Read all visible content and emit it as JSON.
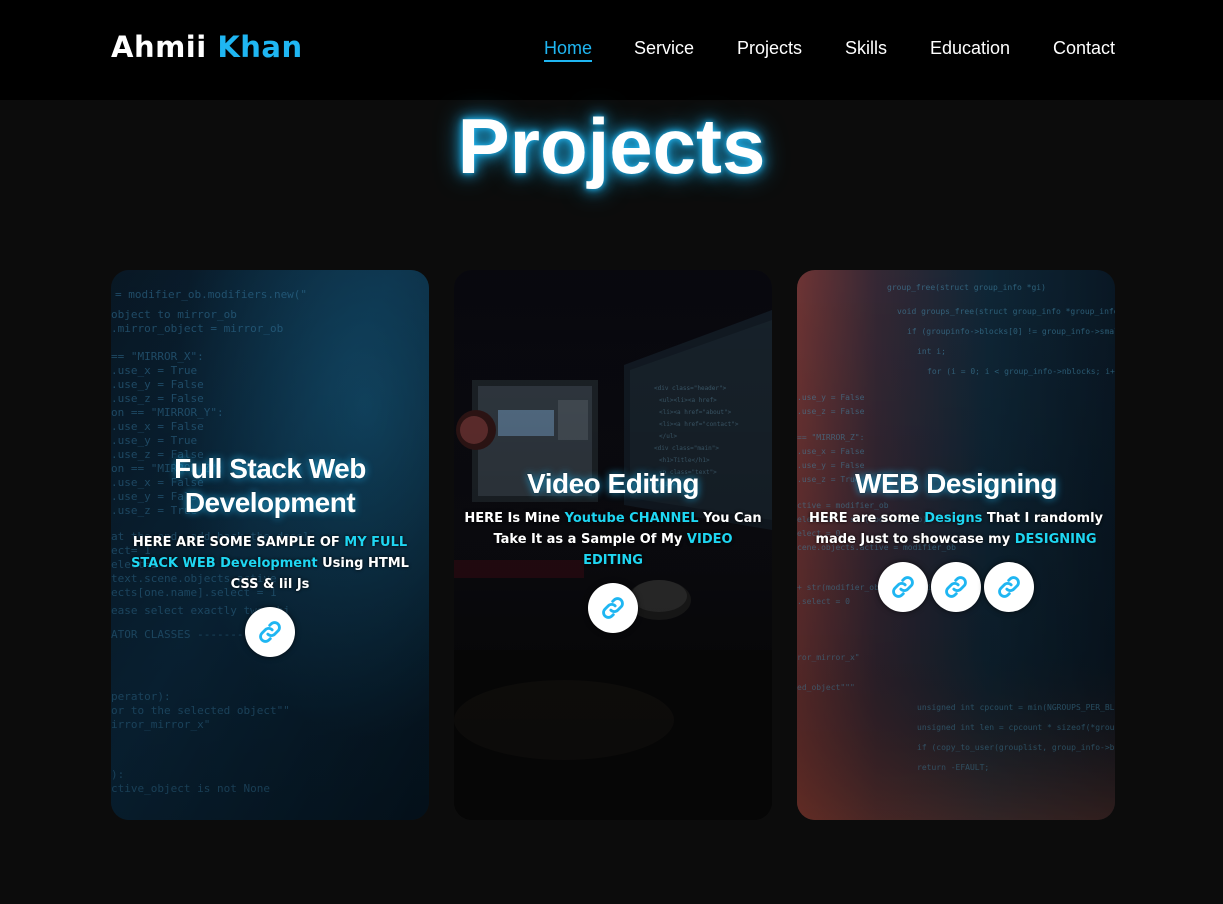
{
  "brand": {
    "first": "Ahmii",
    "last": "Khan"
  },
  "nav": [
    {
      "label": "Home",
      "active": true
    },
    {
      "label": "Service",
      "active": false
    },
    {
      "label": "Projects",
      "active": false
    },
    {
      "label": "Skills",
      "active": false
    },
    {
      "label": "Education",
      "active": false
    },
    {
      "label": "Contact",
      "active": false
    }
  ],
  "section_title": "Projects",
  "colors": {
    "accent": "#1fb6f2",
    "highlight": "#1fd6f2",
    "navbar": "#000000",
    "page": "#0c0c0c"
  },
  "cards": [
    {
      "title_line1": "Full Stack Web",
      "title_line2": "Development",
      "desc": [
        {
          "text": "HERE ARE SOME SAMPLE OF ",
          "hl": false
        },
        {
          "text": "MY FULL STACK WEB Development",
          "hl": true
        },
        {
          "text": " Using HTML CSS & lil Js",
          "hl": false
        }
      ],
      "links": [
        "link-icon"
      ]
    },
    {
      "title_line1": "Video Editing",
      "title_line2": "",
      "desc": [
        {
          "text": "HERE Is Mine ",
          "hl": false
        },
        {
          "text": "Youtube CHANNEL",
          "hl": true
        },
        {
          "text": " You Can Take It as a Sample Of My ",
          "hl": false
        },
        {
          "text": "VIDEO EDITING",
          "hl": true
        }
      ],
      "links": [
        "link-icon"
      ]
    },
    {
      "title_line1": "WEB Designing",
      "title_line2": "",
      "desc": [
        {
          "text": "HERE are some ",
          "hl": false
        },
        {
          "text": "Designs",
          "hl": true
        },
        {
          "text": " That I randomly made Just to showcase my ",
          "hl": false
        },
        {
          "text": "DESIGNING",
          "hl": true
        }
      ],
      "links": [
        "link-icon",
        "link-icon",
        "link-icon"
      ]
    }
  ]
}
